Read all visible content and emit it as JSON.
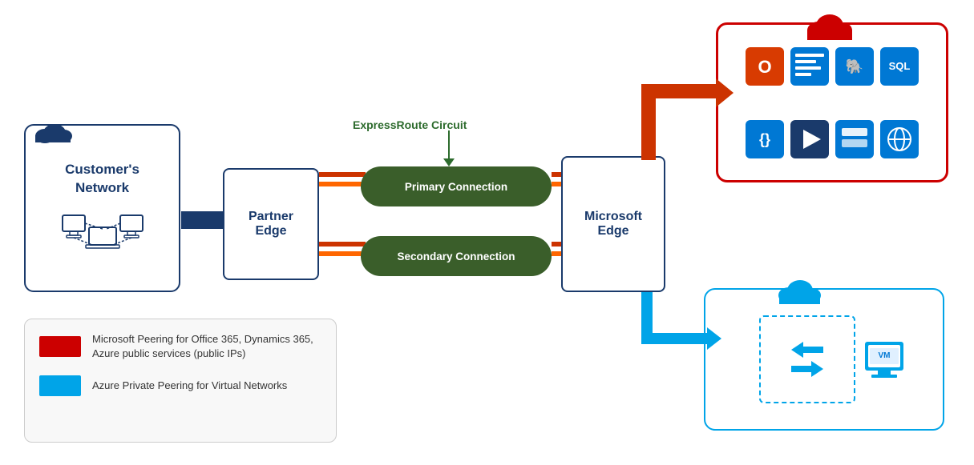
{
  "customer_network": {
    "label": "Customer's\nNetwork"
  },
  "partner_edge": {
    "label": "Partner\nEdge"
  },
  "expressroute": {
    "label": "ExpressRoute Circuit"
  },
  "primary_connection": {
    "label": "Primary Connection"
  },
  "secondary_connection": {
    "label": "Secondary Connection"
  },
  "microsoft_edge": {
    "label": "Microsoft\nEdge"
  },
  "legend": {
    "red_label": "Microsoft Peering for Office 365, Dynamics 365, Azure public services (public IPs)",
    "blue_label": "Azure Private Peering for Virtual Networks"
  }
}
